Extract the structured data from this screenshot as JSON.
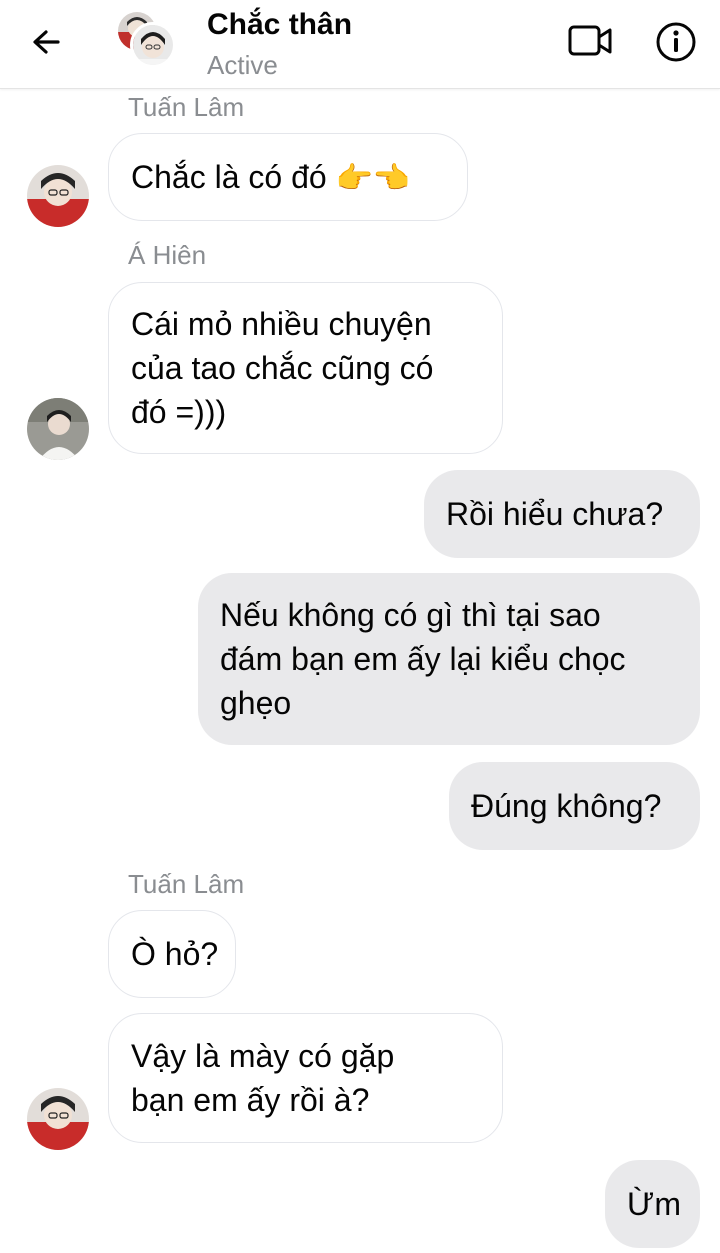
{
  "header": {
    "title": "Chắc thân",
    "status": "Active"
  },
  "messages": [
    {
      "sender": "Tuấn Lâm",
      "text": "Chắc là có đó",
      "emoji": "👉👈"
    },
    {
      "sender": "Á Hiên",
      "lines": [
        "Cái mỏ nhiều chuyện",
        "của tao chắc cũng có",
        "đó =)))"
      ]
    },
    {
      "text": "Rồi hiểu chưa?"
    },
    {
      "lines": [
        "Nếu không có gì thì tại sao",
        "đám bạn em ấy lại kiểu chọc",
        "ghẹo"
      ]
    },
    {
      "text": "Đúng không?"
    },
    {
      "sender": "Tuấn Lâm",
      "text": "Ò hỏ?"
    },
    {
      "lines": [
        "Vậy là mày có gặp",
        "bạn em ấy rồi à?"
      ]
    },
    {
      "text": "Ừm"
    }
  ],
  "colors": {
    "outgoing_bubble": "#e9e9eb",
    "incoming_border": "#e4e6eb",
    "muted_text": "#8a8d91"
  },
  "icons": [
    "back-arrow-icon",
    "video-camera-icon",
    "info-icon"
  ]
}
